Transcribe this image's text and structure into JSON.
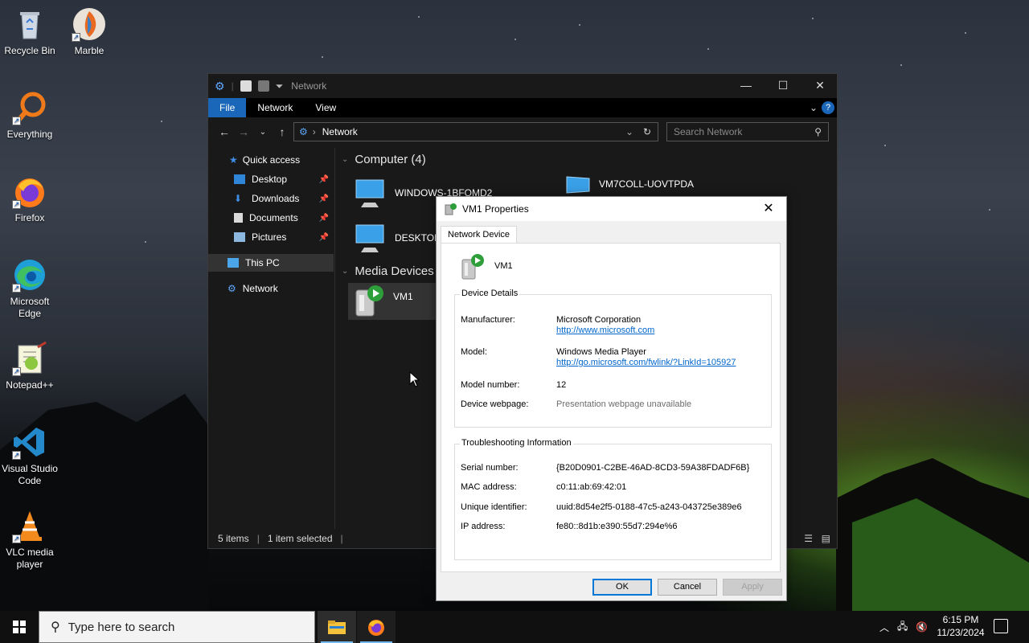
{
  "desktop": {
    "icons": [
      {
        "label": "Recycle Bin",
        "icon": "recycle-bin-icon"
      },
      {
        "label": "Marble",
        "icon": "marble-icon"
      },
      {
        "label": "Everything",
        "icon": "everything-search-icon"
      },
      {
        "label": "Firefox",
        "icon": "firefox-icon"
      },
      {
        "label": "Microsoft Edge",
        "icon": "edge-icon"
      },
      {
        "label": "Notepad++",
        "icon": "notepadpp-icon"
      },
      {
        "label": "Visual Studio Code",
        "icon": "vscode-icon"
      },
      {
        "label": "VLC media player",
        "icon": "vlc-icon"
      }
    ]
  },
  "explorer": {
    "title": "Network",
    "ribbon_tabs": [
      "File",
      "Network",
      "View"
    ],
    "address": "Network",
    "search_placeholder": "Search Network",
    "nav": {
      "quick_access": "Quick access",
      "items": [
        "Desktop",
        "Downloads",
        "Documents",
        "Pictures"
      ],
      "this_pc": "This PC",
      "network": "Network"
    },
    "groups": {
      "computer": "Computer (4)",
      "media": "Media Devices"
    },
    "computers": [
      "WINDOWS-1BFQMD2",
      "VM7COLL-UOVTPDA",
      "DESKTOP-"
    ],
    "media_items": [
      "VM1"
    ],
    "status": {
      "items": "5 items",
      "selected": "1 item selected"
    }
  },
  "dialog": {
    "title": "VM1 Properties",
    "tab": "Network Device",
    "device_name": "VM1",
    "device_details_legend": "Device Details",
    "manufacturer_label": "Manufacturer:",
    "manufacturer_value": "Microsoft Corporation",
    "manufacturer_link": "http://www.microsoft.com",
    "model_label": "Model:",
    "model_value": "Windows Media Player",
    "model_link": "http://go.microsoft.com/fwlink/?LinkId=105927",
    "model_number_label": "Model number:",
    "model_number_value": "12",
    "webpage_label": "Device webpage:",
    "webpage_value": "Presentation webpage unavailable",
    "troubleshooting_legend": "Troubleshooting Information",
    "serial_label": "Serial number:",
    "serial_value": "{B20D0901-C2BE-46AD-8CD3-59A38FDADF6B}",
    "mac_label": "MAC address:",
    "mac_value": "c0:11:ab:69:42:01",
    "uid_label": "Unique identifier:",
    "uid_value": "uuid:8d54e2f5-0188-47c5-a243-043725e389e6",
    "ip_label": "IP address:",
    "ip_value": "fe80::8d1b:e390:55d7:294e%6",
    "buttons": {
      "ok": "OK",
      "cancel": "Cancel",
      "apply": "Apply"
    }
  },
  "taskbar": {
    "search_placeholder": "Type here to search",
    "time": "6:15 PM",
    "date": "11/23/2024"
  }
}
